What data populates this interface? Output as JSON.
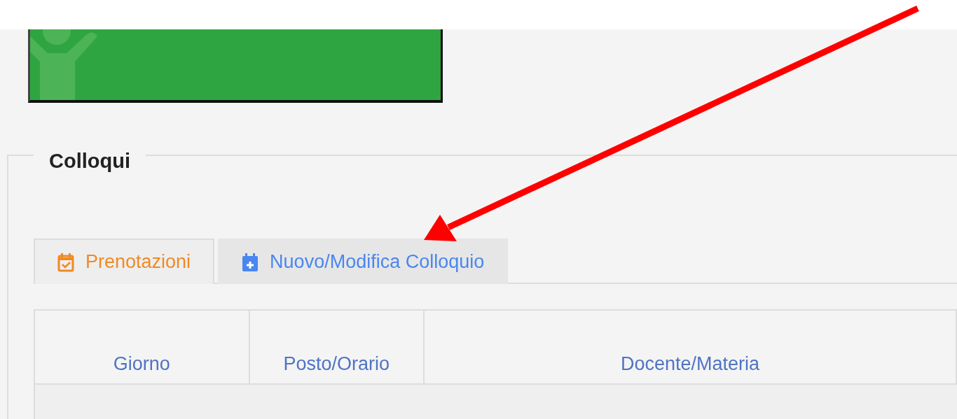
{
  "section": {
    "title": "Colloqui"
  },
  "tabs": [
    {
      "label": "Prenotazioni",
      "selected": true
    },
    {
      "label": "Nuovo/Modifica Colloquio",
      "selected": false
    }
  ],
  "table": {
    "columns": [
      "Giorno",
      "Posto/Orario",
      "Docente/Materia"
    ]
  }
}
